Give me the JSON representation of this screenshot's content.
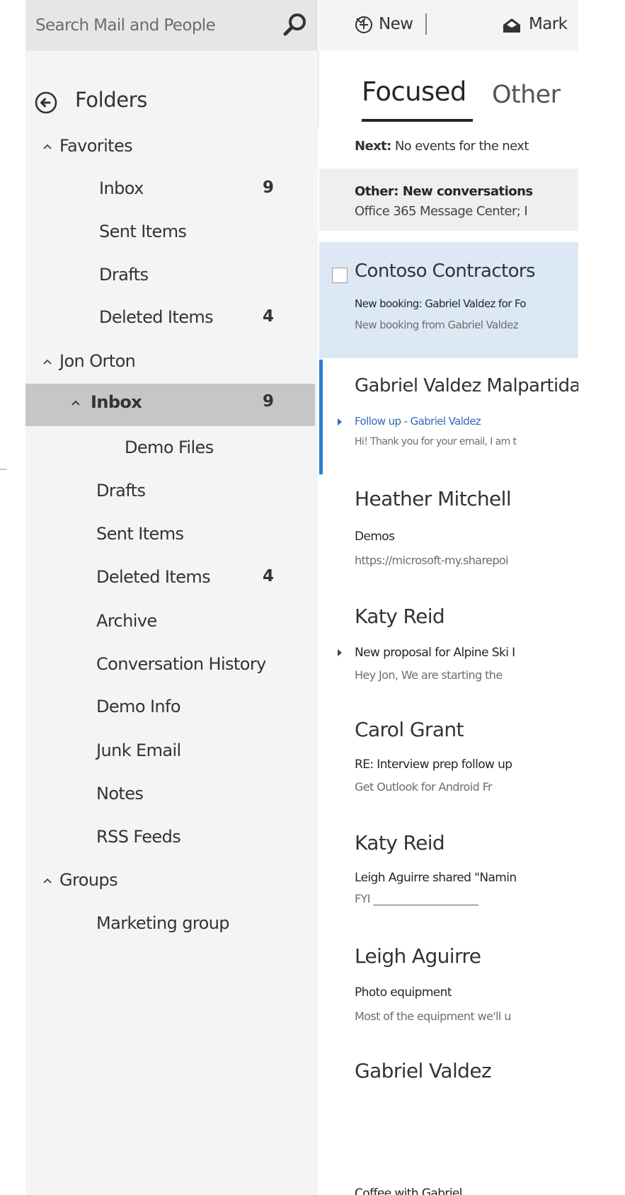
{
  "search": {
    "placeholder": "Search Mail and People"
  },
  "nav": {
    "folders_label": "Folders",
    "favorites": {
      "label": "Favorites",
      "items": [
        {
          "label": "Inbox",
          "count": "9"
        },
        {
          "label": "Sent Items",
          "count": ""
        },
        {
          "label": "Drafts",
          "count": ""
        },
        {
          "label": "Deleted Items",
          "count": "4"
        }
      ]
    },
    "account": {
      "label": "Jon Orton",
      "inbox": {
        "label": "Inbox",
        "count": "9"
      },
      "inbox_children": [
        {
          "label": "Demo Files"
        }
      ],
      "items": [
        {
          "label": "Drafts",
          "count": ""
        },
        {
          "label": "Sent Items",
          "count": ""
        },
        {
          "label": "Deleted Items",
          "count": "4"
        },
        {
          "label": "Archive",
          "count": ""
        },
        {
          "label": "Conversation History",
          "count": ""
        },
        {
          "label": "Demo Info",
          "count": ""
        },
        {
          "label": "Junk Email",
          "count": ""
        },
        {
          "label": "Notes",
          "count": ""
        },
        {
          "label": "RSS Feeds",
          "count": ""
        }
      ]
    },
    "groups": {
      "label": "Groups",
      "items": [
        {
          "label": "Marketing group"
        }
      ]
    }
  },
  "toolbar": {
    "new_label": "New",
    "mark_label": "Mark"
  },
  "tabs": {
    "focused": "Focused",
    "other": "Other"
  },
  "next_events": {
    "label": "Next:",
    "text": "No events for the next"
  },
  "other_banner": {
    "title": "Other: New conversations",
    "subtitle": "Office 365 Message Center; I"
  },
  "messages": [
    {
      "sender": "Contoso Contractors",
      "subject": "New booking: Gabriel Valdez for Fo",
      "preview": "New booking from  Gabriel Valdez"
    },
    {
      "sender": "Gabriel Valdez Malpartida",
      "subject": "Follow up - Gabriel Valdez",
      "preview": "Hi! Thank you for your email, I am t"
    },
    {
      "sender": "Heather Mitchell",
      "subject": "Demos",
      "preview": "https://microsoft-my.sharepoi"
    },
    {
      "sender": "Katy Reid",
      "subject": "New proposal for Alpine Ski I",
      "preview": "Hey Jon,   We are starting the"
    },
    {
      "sender": "Carol Grant",
      "subject": "RE: Interview prep follow up",
      "preview": "Get Outlook for Android    Fr"
    },
    {
      "sender": "Katy Reid",
      "subject": "Leigh Aguirre shared \"Namin",
      "preview": "FYI  ____________________"
    },
    {
      "sender": "Leigh Aguirre",
      "subject": "Photo equipment",
      "preview": "Most of the equipment we'll u"
    },
    {
      "sender": "Gabriel Valdez",
      "subject": "Coffee with Gabriel",
      "preview": ""
    }
  ],
  "colors": {
    "nav_bg": "#f4f4f4",
    "selected_folder_bg": "#c6c6c6",
    "selected_message_bg": "#dce9f4",
    "accent_blue": "#2d7dd2",
    "link_blue": "#2d6bb3"
  },
  "icons": {
    "search": "magnifier-icon",
    "back": "circle-back-arrow-icon",
    "new": "plus-circle-icon",
    "mark": "envelope-open-icon"
  }
}
